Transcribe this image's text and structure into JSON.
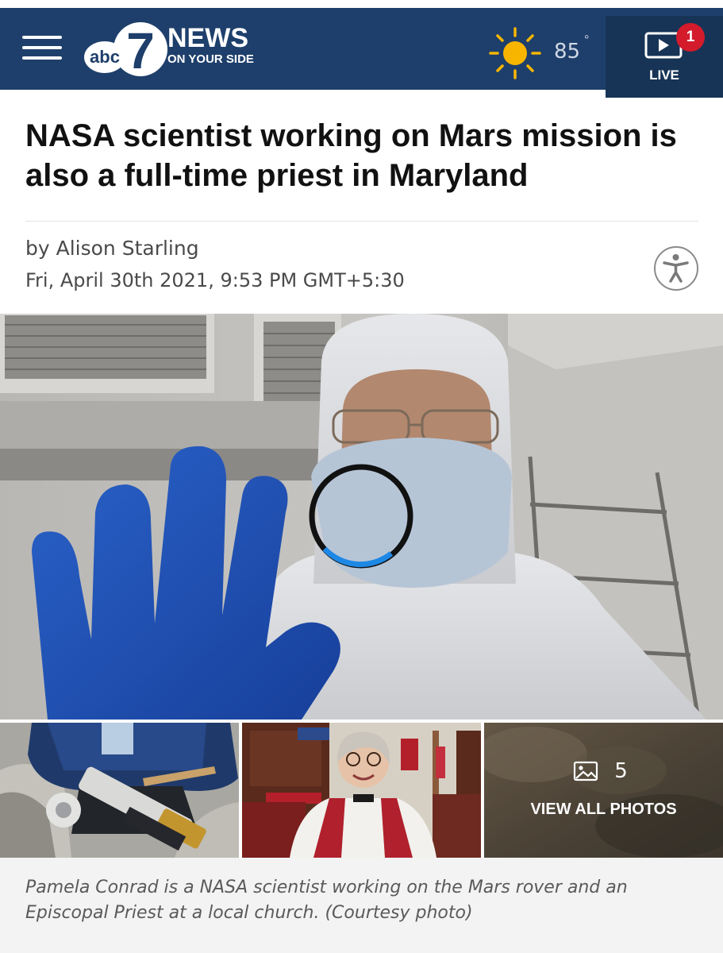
{
  "header": {
    "logo_main": "NEWS",
    "logo_sub": "ON YOUR SIDE",
    "logo_abc": "abc",
    "logo_num": "7",
    "temperature": "85",
    "degree_symbol": "°",
    "live_label": "LIVE",
    "notification_count": "1"
  },
  "article": {
    "headline": "NASA scientist working on Mars mission is also a full-time priest in Maryland",
    "byline": "by Alison Starling",
    "date": "Fri, April 30th 2021, 9:53 PM GMT+5:30"
  },
  "gallery": {
    "photo_count": "5",
    "view_all_label": "VIEW ALL PHOTOS",
    "loading_progress": 0.22
  },
  "caption": "Pamela Conrad is a NASA scientist working on the Mars rover and an Episcopal Priest at a local church. (Courtesy photo)",
  "colors": {
    "navbar": "#1e3f6b",
    "live_bg": "#173456",
    "badge": "#d31b2c",
    "sun": "#f7b500",
    "spinner": "#1e88e5"
  },
  "icons": {
    "menu": "hamburger-menu-icon",
    "weather": "sun-icon",
    "live": "live-video-icon",
    "accessibility": "accessibility-icon",
    "photos": "image-icon"
  }
}
